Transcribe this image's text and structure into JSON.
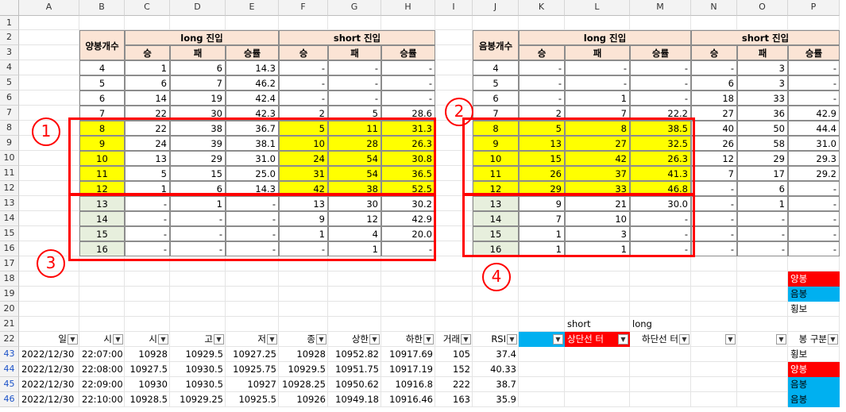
{
  "columns": [
    "A",
    "B",
    "C",
    "D",
    "E",
    "F",
    "G",
    "H",
    "I",
    "J",
    "K",
    "L",
    "M",
    "N",
    "O",
    "P"
  ],
  "rows": [
    1,
    2,
    3,
    4,
    5,
    6,
    7,
    8,
    9,
    10,
    11,
    12,
    13,
    14,
    15,
    16,
    17,
    18,
    19,
    20,
    21,
    22,
    43,
    44,
    45,
    46
  ],
  "left_table": {
    "header_count": "양봉개수",
    "long_title": "long 진입",
    "short_title": "short 진입",
    "sub": [
      "승",
      "패",
      "승률",
      "승",
      "패",
      "승률"
    ],
    "rows": [
      [
        "4",
        "1",
        "6",
        "14.3",
        "-",
        "-",
        "-"
      ],
      [
        "5",
        "6",
        "7",
        "46.2",
        "-",
        "-",
        "-"
      ],
      [
        "6",
        "14",
        "19",
        "42.4",
        "-",
        "-",
        "-"
      ],
      [
        "7",
        "22",
        "30",
        "42.3",
        "2",
        "5",
        "28.6"
      ],
      [
        "8",
        "22",
        "38",
        "36.7",
        "5",
        "11",
        "31.3"
      ],
      [
        "9",
        "24",
        "39",
        "38.1",
        "10",
        "28",
        "26.3"
      ],
      [
        "10",
        "13",
        "29",
        "31.0",
        "24",
        "54",
        "30.8"
      ],
      [
        "11",
        "5",
        "15",
        "25.0",
        "31",
        "54",
        "36.5"
      ],
      [
        "12",
        "1",
        "6",
        "14.3",
        "42",
        "38",
        "52.5"
      ],
      [
        "13",
        "-",
        "1",
        "-",
        "13",
        "30",
        "30.2"
      ],
      [
        "14",
        "-",
        "-",
        "-",
        "9",
        "12",
        "42.9"
      ],
      [
        "15",
        "-",
        "-",
        "-",
        "1",
        "4",
        "20.0"
      ],
      [
        "16",
        "-",
        "-",
        "-",
        "-",
        "1",
        "-"
      ]
    ]
  },
  "right_table": {
    "header_count": "음봉개수",
    "long_title": "long 진입",
    "short_title": "short 진입",
    "sub": [
      "승",
      "패",
      "승률",
      "승",
      "패",
      "승률"
    ],
    "rows": [
      [
        "4",
        "-",
        "-",
        "-",
        "-",
        "3",
        "-"
      ],
      [
        "5",
        "-",
        "-",
        "-",
        "6",
        "3",
        "-"
      ],
      [
        "6",
        "-",
        "1",
        "-",
        "18",
        "33",
        "-"
      ],
      [
        "7",
        "2",
        "7",
        "22.2",
        "27",
        "36",
        "42.9"
      ],
      [
        "8",
        "5",
        "8",
        "38.5",
        "40",
        "50",
        "44.4"
      ],
      [
        "9",
        "13",
        "27",
        "32.5",
        "26",
        "58",
        "31.0"
      ],
      [
        "10",
        "15",
        "42",
        "26.3",
        "12",
        "29",
        "29.3"
      ],
      [
        "11",
        "26",
        "37",
        "41.3",
        "7",
        "17",
        "29.2"
      ],
      [
        "12",
        "29",
        "33",
        "46.8",
        "-",
        "6",
        "-"
      ],
      [
        "13",
        "9",
        "21",
        "30.0",
        "-",
        "1",
        "-"
      ],
      [
        "14",
        "7",
        "10",
        "-",
        "-",
        "-",
        "-"
      ],
      [
        "15",
        "1",
        "3",
        "-",
        "-",
        "-",
        "-"
      ],
      [
        "16",
        "1",
        "1",
        "-",
        "-",
        "-",
        "-"
      ]
    ]
  },
  "annotations": [
    "1",
    "2",
    "3",
    "4"
  ],
  "legend": {
    "bull": "양봉",
    "bear": "음봉",
    "flat": "횡보"
  },
  "labels_row21": {
    "short": "short",
    "long": "long"
  },
  "header_row22": [
    "일",
    "시",
    "시",
    "고",
    "저",
    "종",
    "상한",
    "하한",
    "거래",
    "RSI",
    "",
    "상단선 터",
    "하단선 터",
    "",
    "",
    "봉 구분"
  ],
  "data_rows": [
    [
      "2022/12/30",
      "22:07:00",
      "10928",
      "10929.5",
      "10927.25",
      "10928",
      "10952.82",
      "10917.69",
      "105",
      "37.4",
      "횡보"
    ],
    [
      "2022/12/30",
      "22:08:00",
      "10927.5",
      "10930.5",
      "10925.75",
      "10929.5",
      "10951.75",
      "10917.19",
      "152",
      "40.33",
      "양봉"
    ],
    [
      "2022/12/30",
      "22:09:00",
      "10930",
      "10930.5",
      "10927",
      "10928.25",
      "10950.62",
      "10916.8",
      "222",
      "38.7",
      "음봉"
    ],
    [
      "2022/12/30",
      "22:10:00",
      "10928.5",
      "10929.25",
      "10925.5",
      "10926",
      "10949.18",
      "10916.46",
      "163",
      "35.9",
      "음봉"
    ]
  ],
  "colors": {
    "yellow": "#ffff00",
    "header_pink": "#fbe4d5",
    "gray_green": "#e7efdd",
    "red": "#ff0000",
    "cyan": "#00b0f0",
    "annotation": "#ff0000"
  }
}
